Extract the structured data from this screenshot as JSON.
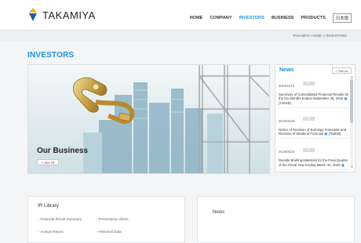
{
  "header": {
    "brand": "TAKAMIYA",
    "nav": [
      "HOME",
      "COMPANY",
      "INVESTORS",
      "BUSINESS",
      "PRODUCTS"
    ],
    "lang_button": "日本語"
  },
  "breadcrumb": "TAKAMIYA HOME  >  INVESTORS",
  "page_title": "INVESTORS",
  "hero": {
    "title": "Our Business",
    "button": "> See All"
  },
  "news": {
    "title": "News",
    "see_all": "> See All",
    "items": [
      {
        "date": "2019/11/19",
        "tag": "IR",
        "text": "Summary of Consolidated Financial Results for the Six Months Ended September 30, 2019",
        "doc": "(742KB)"
      },
      {
        "date": "2019/06/29",
        "tag": "IR",
        "text": "Notice of Revision of Earnings Forecasts and Revision of Dividend Forecast",
        "doc": "(702KB)"
      },
      {
        "date": "2019/05/18",
        "tag": "IR",
        "text": "Results Briefing Materials for the Final Quarter of the Fiscal Year Ending March 31, 2020",
        "doc": ""
      }
    ]
  },
  "ir_library": {
    "title": "IR Library",
    "links": [
      "Financial Result Summary",
      "Presentation Sheet",
      "Analyst Report",
      "Historical Data"
    ]
  },
  "news_box": {
    "title": "News"
  }
}
